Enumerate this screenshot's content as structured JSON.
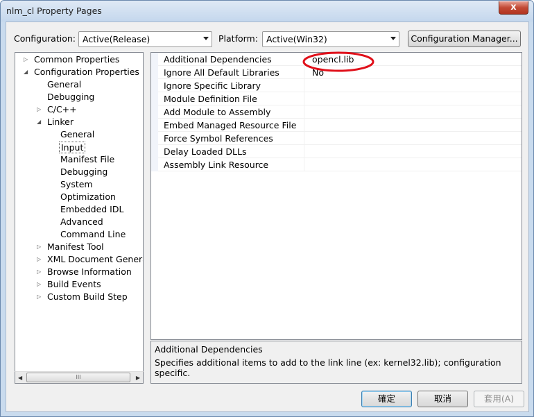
{
  "window": {
    "title": "nlm_cl Property Pages",
    "close_label": "x"
  },
  "header": {
    "configuration_label": "Configuration:",
    "configuration_value": "Active(Release)",
    "platform_label": "Platform:",
    "platform_value": "Active(Win32)",
    "config_manager_label": "Configuration Manager..."
  },
  "tree": [
    {
      "label": "Common Properties",
      "expander": "▷"
    },
    {
      "label": "Configuration Properties",
      "expander": "◢"
    },
    {
      "label": "General",
      "expander": ""
    },
    {
      "label": "Debugging",
      "expander": ""
    },
    {
      "label": "C/C++",
      "expander": "▷"
    },
    {
      "label": "Linker",
      "expander": "◢"
    },
    {
      "label": "General",
      "expander": ""
    },
    {
      "label": "Input",
      "expander": "",
      "selected": true
    },
    {
      "label": "Manifest File",
      "expander": ""
    },
    {
      "label": "Debugging",
      "expander": ""
    },
    {
      "label": "System",
      "expander": ""
    },
    {
      "label": "Optimization",
      "expander": ""
    },
    {
      "label": "Embedded IDL",
      "expander": ""
    },
    {
      "label": "Advanced",
      "expander": ""
    },
    {
      "label": "Command Line",
      "expander": ""
    },
    {
      "label": "Manifest Tool",
      "expander": "▷"
    },
    {
      "label": "XML Document Generato",
      "expander": "▷"
    },
    {
      "label": "Browse Information",
      "expander": "▷"
    },
    {
      "label": "Build Events",
      "expander": "▷"
    },
    {
      "label": "Custom Build Step",
      "expander": "▷"
    }
  ],
  "scrollbar": {
    "left": "◀",
    "right": "▶",
    "grip": "III"
  },
  "properties": [
    {
      "name": "Additional Dependencies",
      "value": "opencl.lib"
    },
    {
      "name": "Ignore All Default Libraries",
      "value": "No"
    },
    {
      "name": "Ignore Specific Library",
      "value": ""
    },
    {
      "name": "Module Definition File",
      "value": ""
    },
    {
      "name": "Add Module to Assembly",
      "value": ""
    },
    {
      "name": "Embed Managed Resource File",
      "value": ""
    },
    {
      "name": "Force Symbol References",
      "value": ""
    },
    {
      "name": "Delay Loaded DLLs",
      "value": ""
    },
    {
      "name": "Assembly Link Resource",
      "value": ""
    }
  ],
  "description": {
    "title": "Additional Dependencies",
    "text": "Specifies additional items to add to the link line (ex: kernel32.lib); configuration specific."
  },
  "buttons": {
    "ok": "確定",
    "cancel": "取消",
    "apply": "套用(A)"
  },
  "colors": {
    "annotation": "#e0101a",
    "selection_border": "#3c7fb1"
  }
}
